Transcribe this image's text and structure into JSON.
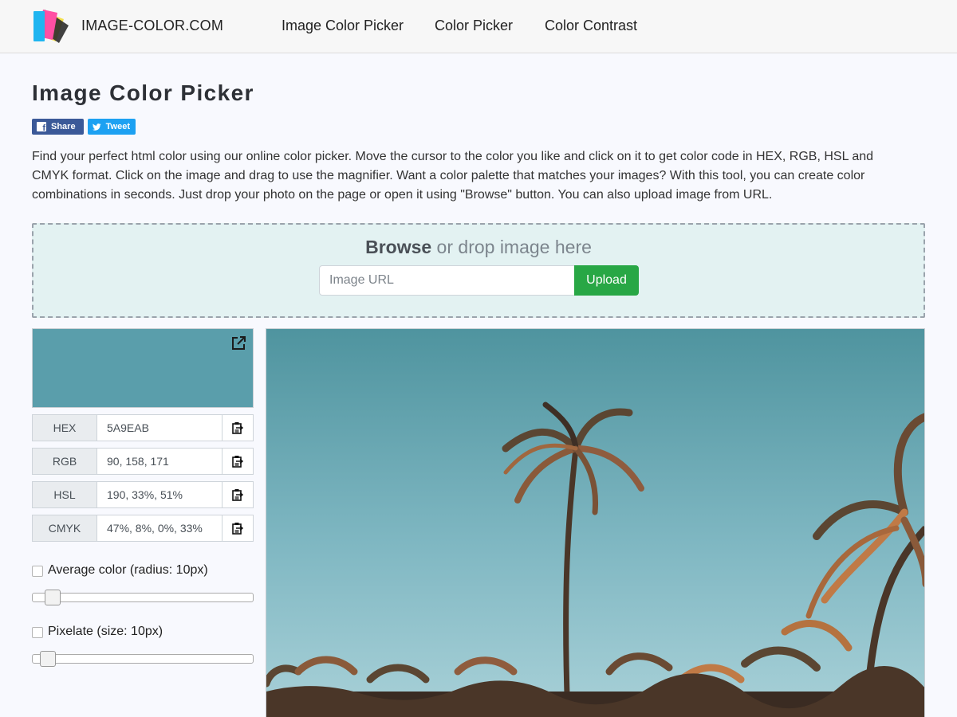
{
  "header": {
    "brand": "IMAGE-COLOR.COM",
    "nav": [
      "Image Color Picker",
      "Color Picker",
      "Color Contrast"
    ]
  },
  "page": {
    "title": "Image Color Picker",
    "share_label": "Share",
    "tweet_label": "Tweet",
    "intro": "Find your perfect html color using our online color picker. Move the cursor to the color you like and click on it to get color code in HEX, RGB, HSL and CMYK format. Click on the image and drag to use the magnifier. Want a color palette that matches your images? With this tool, you can create color combinations in seconds. Just drop your photo on the page or open it using \"Browse\" button. You can also upload image from URL."
  },
  "dropzone": {
    "browse": "Browse",
    "drop_text": " or drop image here",
    "url_placeholder": "Image URL",
    "upload_label": "Upload"
  },
  "picker": {
    "swatch_color": "#5A9EAB",
    "rows": [
      {
        "label": "HEX",
        "value": "5A9EAB"
      },
      {
        "label": "RGB",
        "value": "90, 158, 171"
      },
      {
        "label": "HSL",
        "value": "190, 33%, 51%"
      },
      {
        "label": "CMYK",
        "value": "47%, 8%, 0%, 33%"
      }
    ],
    "average_label": "Average color (radius: 10px)",
    "average_checked": false,
    "pixelate_label": "Pixelate (size: 10px)",
    "pixelate_checked": false
  },
  "colors": {
    "accent_green": "#28a745",
    "facebook": "#3b5998",
    "twitter": "#1da1f2"
  }
}
